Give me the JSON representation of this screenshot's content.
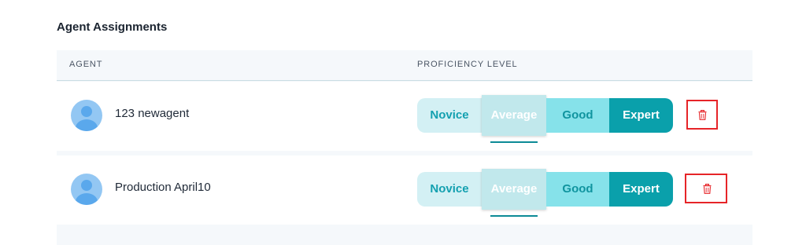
{
  "section_title": "Agent Assignments",
  "table": {
    "columns": [
      "AGENT",
      "PROFICIENCY LEVEL"
    ]
  },
  "levels": [
    "Novice",
    "Average",
    "Good",
    "Expert"
  ],
  "rows": [
    {
      "agent": "123 newagent",
      "selected_level": "Average"
    },
    {
      "agent": "Production April10",
      "selected_level": "Average"
    }
  ],
  "colors": {
    "accent": "#0aa0ab",
    "delete_border": "#e62428",
    "avatar": "#93c7f3"
  },
  "icons": {
    "avatar": "user-avatar-icon",
    "delete": "trash-icon"
  }
}
